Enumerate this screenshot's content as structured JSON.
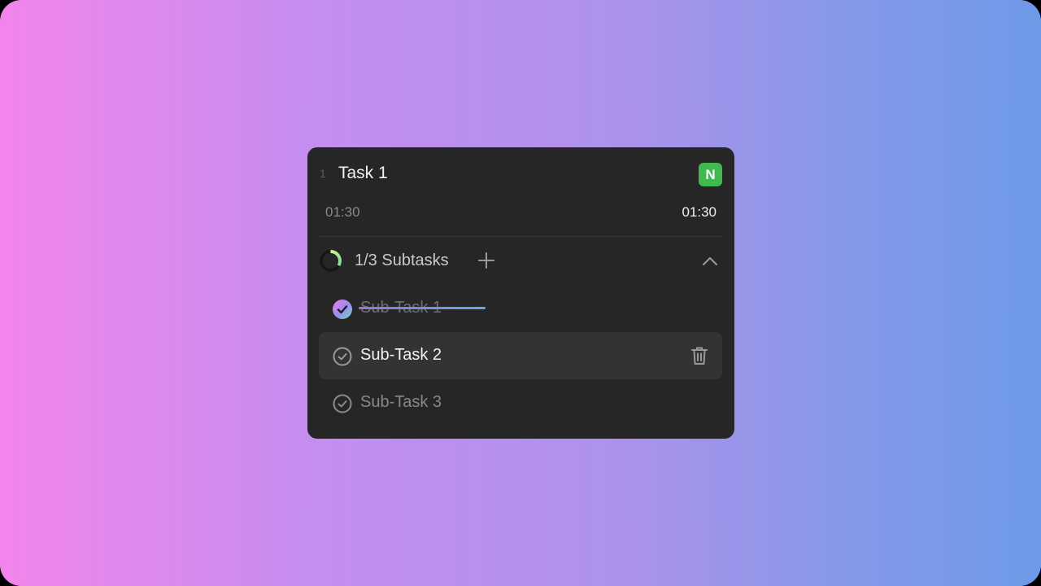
{
  "task": {
    "index": "1",
    "title": "Task 1",
    "badge": "N",
    "badge_color": "#3fb950",
    "time_elapsed": "01:30",
    "time_total": "01:30"
  },
  "subtasks": {
    "summary": "1/3 Subtasks",
    "completed": 1,
    "total": 3,
    "items": [
      {
        "label": "Sub-Task 1",
        "done": true
      },
      {
        "label": "Sub-Task 2",
        "done": false
      },
      {
        "label": "Sub-Task 3",
        "done": false
      }
    ]
  },
  "icons": {
    "add": "plus-icon",
    "collapse": "chevron-up-icon",
    "delete": "trash-icon",
    "check": "check-circle-icon",
    "progress": "progress-ring-icon"
  },
  "colors": {
    "card_background": "#262626",
    "hover_row": "#333333",
    "gradient_start": "#f285ec",
    "gradient_end": "#6d9ae8"
  }
}
